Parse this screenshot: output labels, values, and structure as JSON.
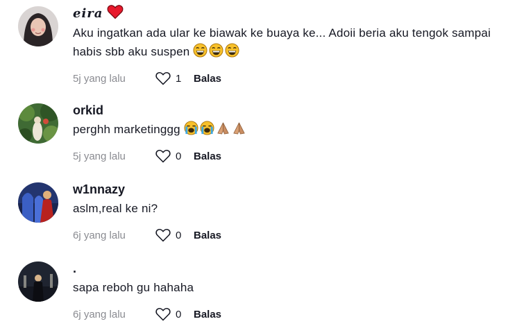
{
  "comments": [
    {
      "username": "eira",
      "text": "Aku ingatkan ada ular ke biawak ke buaya ke... Adoii beria aku tengok sampai habis sbb aku suspen",
      "emojis": [
        "grin-sweat-emoji",
        "grin-sweat-emoji",
        "grin-sweat-emoji"
      ],
      "time": "5j yang lalu",
      "likes": "1",
      "reply": "Balas"
    },
    {
      "username": "orkid",
      "text": "perghh marketinggg",
      "emojis": [
        "loudly-crying-emoji",
        "loudly-crying-emoji",
        "folded-hands-emoji",
        "folded-hands-emoji"
      ],
      "time": "5j yang lalu",
      "likes": "0",
      "reply": "Balas"
    },
    {
      "username": "w1nnazy",
      "text": "aslm,real ke ni?",
      "emojis": [],
      "time": "6j yang lalu",
      "likes": "0",
      "reply": "Balas"
    },
    {
      "username": ".",
      "text": "sapa reboh gu hahaha",
      "emojis": [],
      "time": "6j yang lalu",
      "likes": "0",
      "reply": "Balas"
    }
  ],
  "colors": {
    "heart": "#e8192c",
    "muted": "#8a8b91",
    "text": "#161823"
  }
}
